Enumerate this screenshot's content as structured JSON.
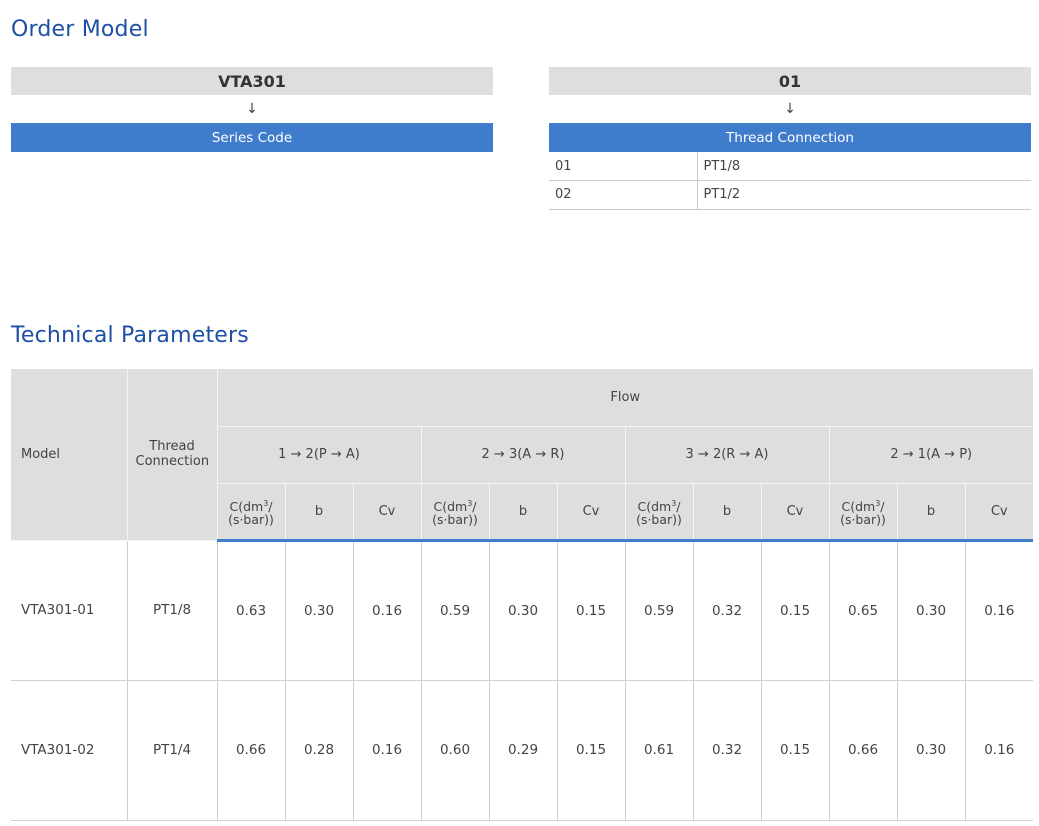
{
  "order_model": {
    "title": "Order Model",
    "series": {
      "code": "VTA301",
      "arrow": "↓",
      "label": "Series Code"
    },
    "thread": {
      "code": "01",
      "arrow": "↓",
      "label": "Thread Connection",
      "options": [
        {
          "code": "01",
          "value": "PT1/8"
        },
        {
          "code": "02",
          "value": "PT1/2"
        }
      ]
    }
  },
  "technical_parameters": {
    "title": "Technical Parameters",
    "headers": {
      "model": "Model",
      "thread": "Thread Connection",
      "flow": "Flow",
      "directions": [
        "1 → 2(P → A)",
        "2 → 3(A → R)",
        "3 → 2(R → A)",
        "2 → 1(A → P)"
      ],
      "sub_c_line1": "C(dm",
      "sub_c_sup": "3",
      "sub_c_line1_end": "/",
      "sub_c_line2": "(s·bar))",
      "sub_b": "b",
      "sub_cv": "Cv"
    },
    "rows": [
      {
        "model": "VTA301-01",
        "thread": "PT1/8",
        "values": [
          "0.63",
          "0.30",
          "0.16",
          "0.59",
          "0.30",
          "0.15",
          "0.59",
          "0.32",
          "0.15",
          "0.65",
          "0.30",
          "0.16"
        ]
      },
      {
        "model": "VTA301-02",
        "thread": "PT1/4",
        "values": [
          "0.66",
          "0.28",
          "0.16",
          "0.60",
          "0.29",
          "0.15",
          "0.61",
          "0.32",
          "0.15",
          "0.66",
          "0.30",
          "0.16"
        ]
      }
    ]
  },
  "colors": {
    "title": "#1e4fa6",
    "accent": "#3f7ccc",
    "header_bg": "#dedede"
  }
}
